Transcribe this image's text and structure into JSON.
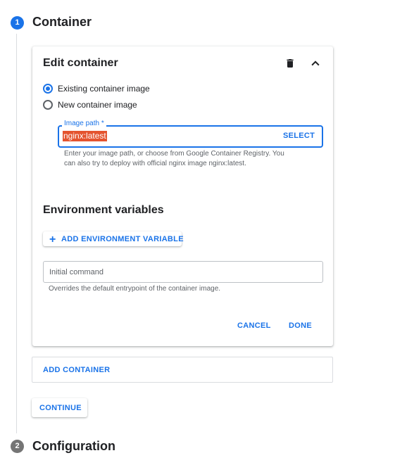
{
  "steps": [
    {
      "number": "1",
      "title": "Container",
      "color": "#1a73e8"
    },
    {
      "number": "2",
      "title": "Configuration",
      "color": "#757575"
    }
  ],
  "card": {
    "title": "Edit container",
    "delete_icon": "trash-icon",
    "collapse_icon": "chevron-up-icon",
    "radios": {
      "existing": {
        "label": "Existing container image",
        "checked": true
      },
      "new": {
        "label": "New container image",
        "checked": false
      }
    },
    "image_path": {
      "label": "Image path *",
      "value": "nginx:latest",
      "select_label": "SELECT",
      "hint_line1": "Enter your image path, or choose from Google Container Registry. You",
      "hint_line2": "can also try to deploy with official nginx image nginx:latest."
    },
    "env": {
      "title": "Environment variables",
      "add_label": "ADD ENVIRONMENT VARIABLE"
    },
    "initial_command": {
      "placeholder": "Initial command",
      "hint": "Overrides the default entrypoint of the container image."
    },
    "cancel_label": "CANCEL",
    "done_label": "DONE"
  },
  "add_container_label": "ADD CONTAINER",
  "continue_label": "CONTINUE",
  "colors": {
    "accent": "#1a73e8",
    "selection": "#e4542f",
    "muted_step": "#757575"
  }
}
